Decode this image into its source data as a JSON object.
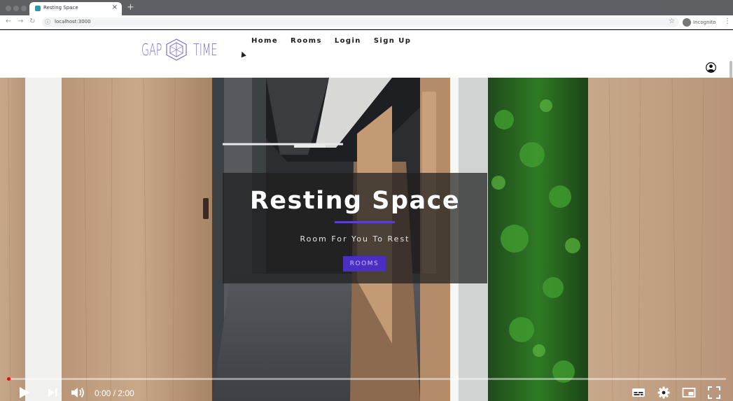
{
  "browser": {
    "tab_title": "Resting Space",
    "tab_close": "×",
    "new_tab": "+",
    "url": "localhost:3000",
    "incognito_label": "Incognito"
  },
  "site": {
    "logo_left": "GAP",
    "logo_right": "TIME",
    "nav": [
      "Home",
      "Rooms",
      "Login",
      "Sign Up"
    ]
  },
  "hero": {
    "title": "Resting Space",
    "subtitle": "Room For You To Rest",
    "button_label": "ROOMS"
  },
  "video": {
    "time": "0:00 / 2:00",
    "progress": 0
  },
  "colors": {
    "accent": "#4b2fc4",
    "logo": "#7d6fcf"
  }
}
